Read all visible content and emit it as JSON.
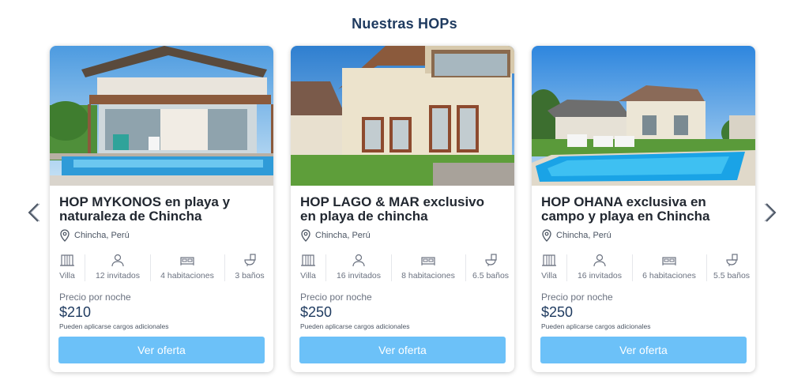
{
  "section_title": "Nuestras HOPs",
  "nav": {
    "prev_icon": "chevron-left-icon",
    "next_icon": "chevron-right-icon"
  },
  "colors": {
    "title": "#1e3a5f",
    "button": "#6cc1f8",
    "text": "#222831"
  },
  "cards": [
    {
      "title_line1": "HOP MYKONOS en playa y",
      "title_line2": "naturaleza de Chincha",
      "location": "Chincha, Perú",
      "features": {
        "type": "Villa",
        "guests": "12 invitados",
        "rooms": "4 habitaciones",
        "baths": "3 baños"
      },
      "price_label": "Precio por noche",
      "price": "$210",
      "note": "Pueden aplicarse cargos adicionales",
      "button": "Ver oferta"
    },
    {
      "title_line1": "HOP LAGO & MAR exclusivo",
      "title_line2": "en playa de chincha",
      "location": "Chincha, Perú",
      "features": {
        "type": "Villa",
        "guests": "16 invitados",
        "rooms": "8 habitaciones",
        "baths": "6.5 baños"
      },
      "price_label": "Precio por noche",
      "price": "$250",
      "note": "Pueden aplicarse cargos adicionales",
      "button": "Ver oferta"
    },
    {
      "title_line1": "HOP OHANA exclusiva en",
      "title_line2": "campo y playa en Chincha",
      "location": "Chincha, Perú",
      "features": {
        "type": "Villa",
        "guests": "16 invitados",
        "rooms": "6 habitaciones",
        "baths": "5.5 baños"
      },
      "price_label": "Precio por noche",
      "price": "$250",
      "note": "Pueden aplicarse cargos adicionales",
      "button": "Ver oferta"
    }
  ]
}
